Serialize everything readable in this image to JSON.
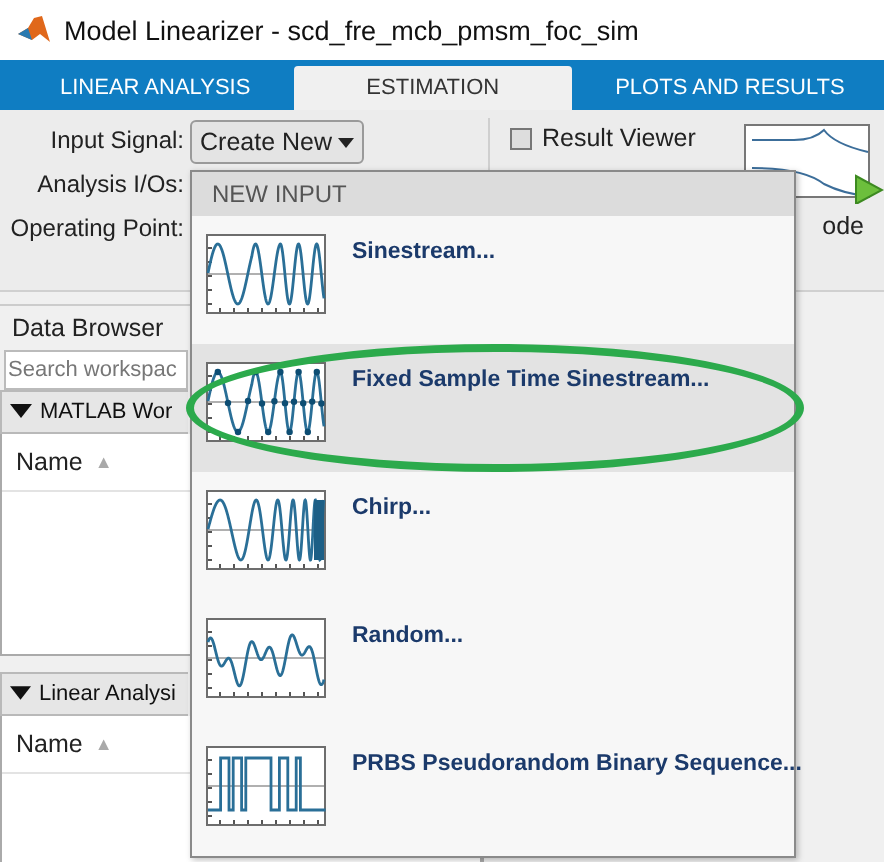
{
  "window": {
    "title": "Model Linearizer - scd_fre_mcb_pmsm_foc_sim"
  },
  "tabs": [
    {
      "label": "LINEAR ANALYSIS",
      "selected": false
    },
    {
      "label": "ESTIMATION",
      "selected": true
    },
    {
      "label": "PLOTS AND RESULTS",
      "selected": false
    }
  ],
  "toolstrip": {
    "input_signal_label": "Input Signal:",
    "input_signal_dropdown": "Create New",
    "analysis_ios_label": "Analysis I/Os:",
    "operating_point_label": "Operating Point:",
    "result_viewer": {
      "label": "Result Viewer",
      "checked": false
    },
    "plot_button_label": "ode"
  },
  "data_browser": {
    "title": "Data Browser",
    "search": {
      "placeholder": "Search workspac"
    },
    "sections": [
      {
        "title": "MATLAB Wor",
        "expanded": true,
        "column": "Name",
        "sort_indicator": "▲"
      },
      {
        "title": "Linear Analysi",
        "expanded": true,
        "column": "Name",
        "sort_indicator": "▲"
      }
    ]
  },
  "menu": {
    "header": "NEW INPUT",
    "items": [
      {
        "label": "Sinestream...",
        "kind": "sinestream",
        "selected": false,
        "circled": false
      },
      {
        "label": "Fixed Sample Time Sinestream...",
        "kind": "sampled",
        "selected": true,
        "circled": true
      },
      {
        "label": "Chirp...",
        "kind": "chirp",
        "selected": false,
        "circled": false
      },
      {
        "label": "Random...",
        "kind": "random",
        "selected": false,
        "circled": false
      },
      {
        "label": "PRBS Pseudorandom Binary Sequence...",
        "kind": "prbs",
        "selected": false,
        "circled": false
      }
    ]
  }
}
